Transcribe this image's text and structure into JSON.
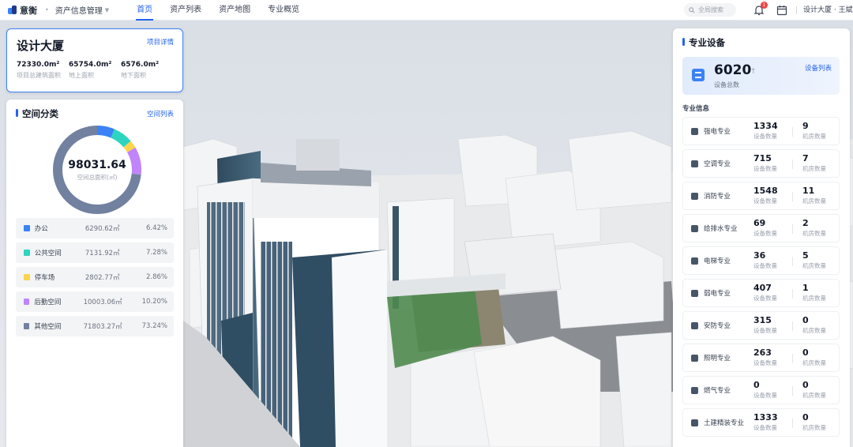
{
  "app": {
    "logo_text": "意衡"
  },
  "nav": {
    "dropdown_label": "资产信息管理",
    "tabs": [
      {
        "label": "首页",
        "active": true
      },
      {
        "label": "资产列表",
        "active": false
      },
      {
        "label": "资产地图",
        "active": false
      },
      {
        "label": "专业概览",
        "active": false
      }
    ]
  },
  "search": {
    "placeholder": "全局搜索"
  },
  "notifications": {
    "count": "1"
  },
  "user": {
    "label": "设计大厦 · 王斌"
  },
  "building": {
    "title": "设计大厦",
    "detail_link": "项目详情",
    "stats": [
      {
        "value": "72330.0m²",
        "label": "项目总建筑面积"
      },
      {
        "value": "65754.0m²",
        "label": "地上面积"
      },
      {
        "value": "6576.0m²",
        "label": "地下面积"
      }
    ]
  },
  "space": {
    "title": "空间分类",
    "list_link": "空间列表",
    "total_value": "98031.64",
    "total_label": "空间总面积(㎡)",
    "categories": [
      {
        "name": "办公",
        "area": "6290.62㎡",
        "percent": "6.42%",
        "share": 6.42,
        "color": "#3b82f6"
      },
      {
        "name": "公共空间",
        "area": "7131.92㎡",
        "percent": "7.28%",
        "share": 7.28,
        "color": "#2dd4bf"
      },
      {
        "name": "停车场",
        "area": "2802.77㎡",
        "percent": "2.86%",
        "share": 2.86,
        "color": "#fcd34d"
      },
      {
        "name": "后勤空间",
        "area": "10003.06㎡",
        "percent": "10.20%",
        "share": 10.2,
        "color": "#c084fc"
      },
      {
        "name": "其他空间",
        "area": "71803.27㎡",
        "percent": "73.24%",
        "share": 73.24,
        "color": "#71819f"
      }
    ]
  },
  "equipment": {
    "title": "专业设备",
    "list_link": "设备列表",
    "total_value": "6020",
    "total_arrow": "↑",
    "total_label": "设备总数",
    "sub_title": "专业信息",
    "count_label": "设备数量",
    "room_label": "机房数量",
    "items": [
      {
        "name": "强电专业",
        "devices": "1334",
        "rooms": "9",
        "icon": "lightning-icon"
      },
      {
        "name": "空调专业",
        "devices": "715",
        "rooms": "7",
        "icon": "fan-icon"
      },
      {
        "name": "消防专业",
        "devices": "1548",
        "rooms": "11",
        "icon": "fire-extinguisher-icon"
      },
      {
        "name": "给排水专业",
        "devices": "69",
        "rooms": "2",
        "icon": "water-pipe-icon"
      },
      {
        "name": "电梯专业",
        "devices": "36",
        "rooms": "5",
        "icon": "elevator-icon"
      },
      {
        "name": "弱电专业",
        "devices": "407",
        "rooms": "1",
        "icon": "monitor-icon"
      },
      {
        "name": "安防专业",
        "devices": "315",
        "rooms": "0",
        "icon": "camera-icon"
      },
      {
        "name": "照明专业",
        "devices": "263",
        "rooms": "0",
        "icon": "bulb-icon"
      },
      {
        "name": "燃气专业",
        "devices": "0",
        "rooms": "0",
        "icon": "flame-icon"
      },
      {
        "name": "土建精装专业",
        "devices": "1333",
        "rooms": "0",
        "icon": "building-grid-icon"
      }
    ]
  }
}
